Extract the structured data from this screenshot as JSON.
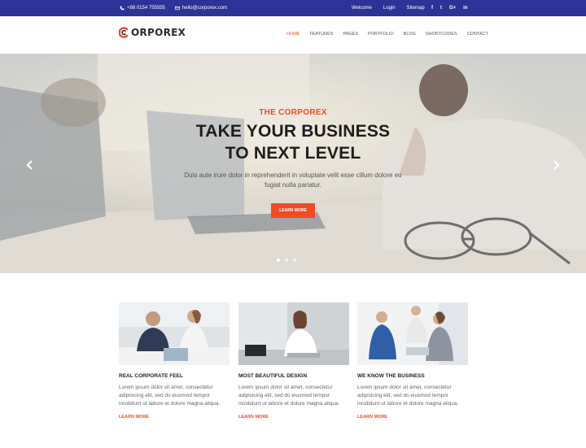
{
  "topbar": {
    "phone": "+88 0154 755555",
    "email": "hello@corporex.com",
    "links": [
      "Welcome",
      "Login",
      "Sitemap"
    ],
    "social": [
      "f",
      "t",
      "G+",
      "in"
    ]
  },
  "header": {
    "logo_text": "ORPOREX",
    "nav": [
      "HOME",
      "FEATURES",
      "PAGES",
      "PORTFOLIO",
      "BLOG",
      "SHORTCODES",
      "CONTACT"
    ],
    "active_nav": "HOME"
  },
  "hero": {
    "eyebrow": "THE CORPOREX",
    "title_line1": "TAKE YOUR BUSINESS",
    "title_line2": "TO NEXT LEVEL",
    "subtitle": "Duis aute irure dolor in reprehenderit in voluptate velit esse cillum dolore eu fugiat nulla pariatur.",
    "button_label": "LEARN MORE",
    "slides": 3,
    "active_slide": 0
  },
  "features": [
    {
      "title": "REAL CORPORATE FEEL",
      "text": "Lorem ipsum dolor sit amet, consectetur adipisicing elit, sed do eiusmod tempor incididunt ut labore et dolore magna aliqua.",
      "more": "LEARN MORE"
    },
    {
      "title": "MOST BEAUTIFUL DESIGN",
      "text": "Lorem ipsum dolor sit amet, consectetur adipisicing elit, sed do eiusmod tempor incididunt ut labore et dolore magna aliqua.",
      "more": "LEARN MORE"
    },
    {
      "title": "WE KNOW THE BUSINESS",
      "text": "Lorem ipsum dolor sit amet, consectetur adipisicing elit, sed do eiusmod tempor incididunt ut labore et dolore magna aliqua.",
      "more": "LEARN MORE"
    }
  ],
  "colors": {
    "topbar": "#2c3396",
    "accent": "#ef4b24",
    "heading": "#1d1d1d"
  },
  "icons": [
    "phone-icon",
    "mail-icon",
    "logo-mark-icon",
    "chevron-left-icon",
    "chevron-right-icon"
  ]
}
